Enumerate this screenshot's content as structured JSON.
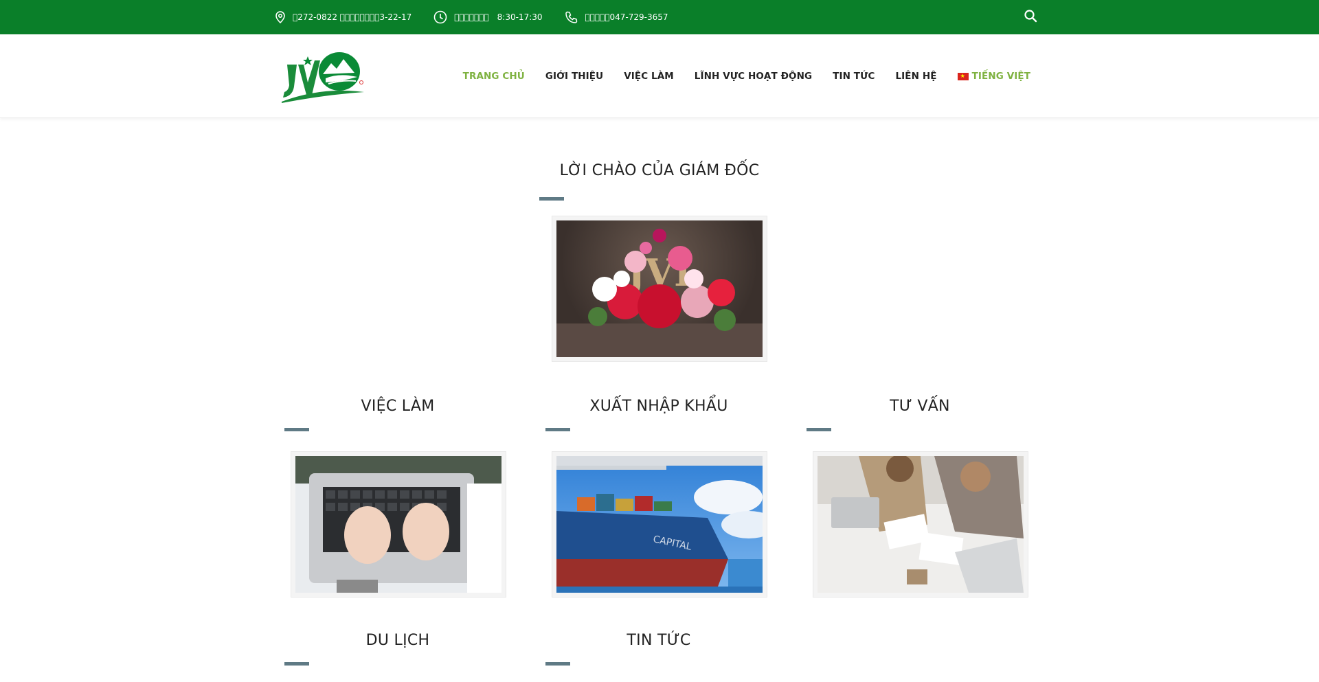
{
  "topbar": {
    "address": "\u0000272-0822 \u0000\u0000\u0000\u0000\u0000\u0000\u0000\u00003-22-17",
    "hours_label": "\u0000\u0000\u0000\u0000\u0000\u0000\u0000",
    "hours_value": "8:30-17:30",
    "phone": "\u0000\u0000\u0000\u0000\u0000047-729-3657"
  },
  "nav": {
    "items": [
      "TRANG CHỦ",
      "GIỚI THIỆU",
      "VIỆC LÀM",
      "LĨNH VỰC HOẠT ĐỘNG",
      "TIN TỨC",
      "LIÊN HỆ"
    ],
    "lang": "TIẾNG VIỆT"
  },
  "welcome": {
    "title": "LỜI CHÀO CỦA GIÁM ĐỐC"
  },
  "sections": [
    {
      "title": "VIỆC LÀM"
    },
    {
      "title": "XUẤT NHẬP KHẨU"
    },
    {
      "title": "TƯ VẤN"
    },
    {
      "title": "DU LỊCH"
    },
    {
      "title": "TIN TỨC"
    }
  ],
  "colors": {
    "topbar": "#0a7f29",
    "accent": "#7fb241",
    "bar": "#5f7a85"
  }
}
